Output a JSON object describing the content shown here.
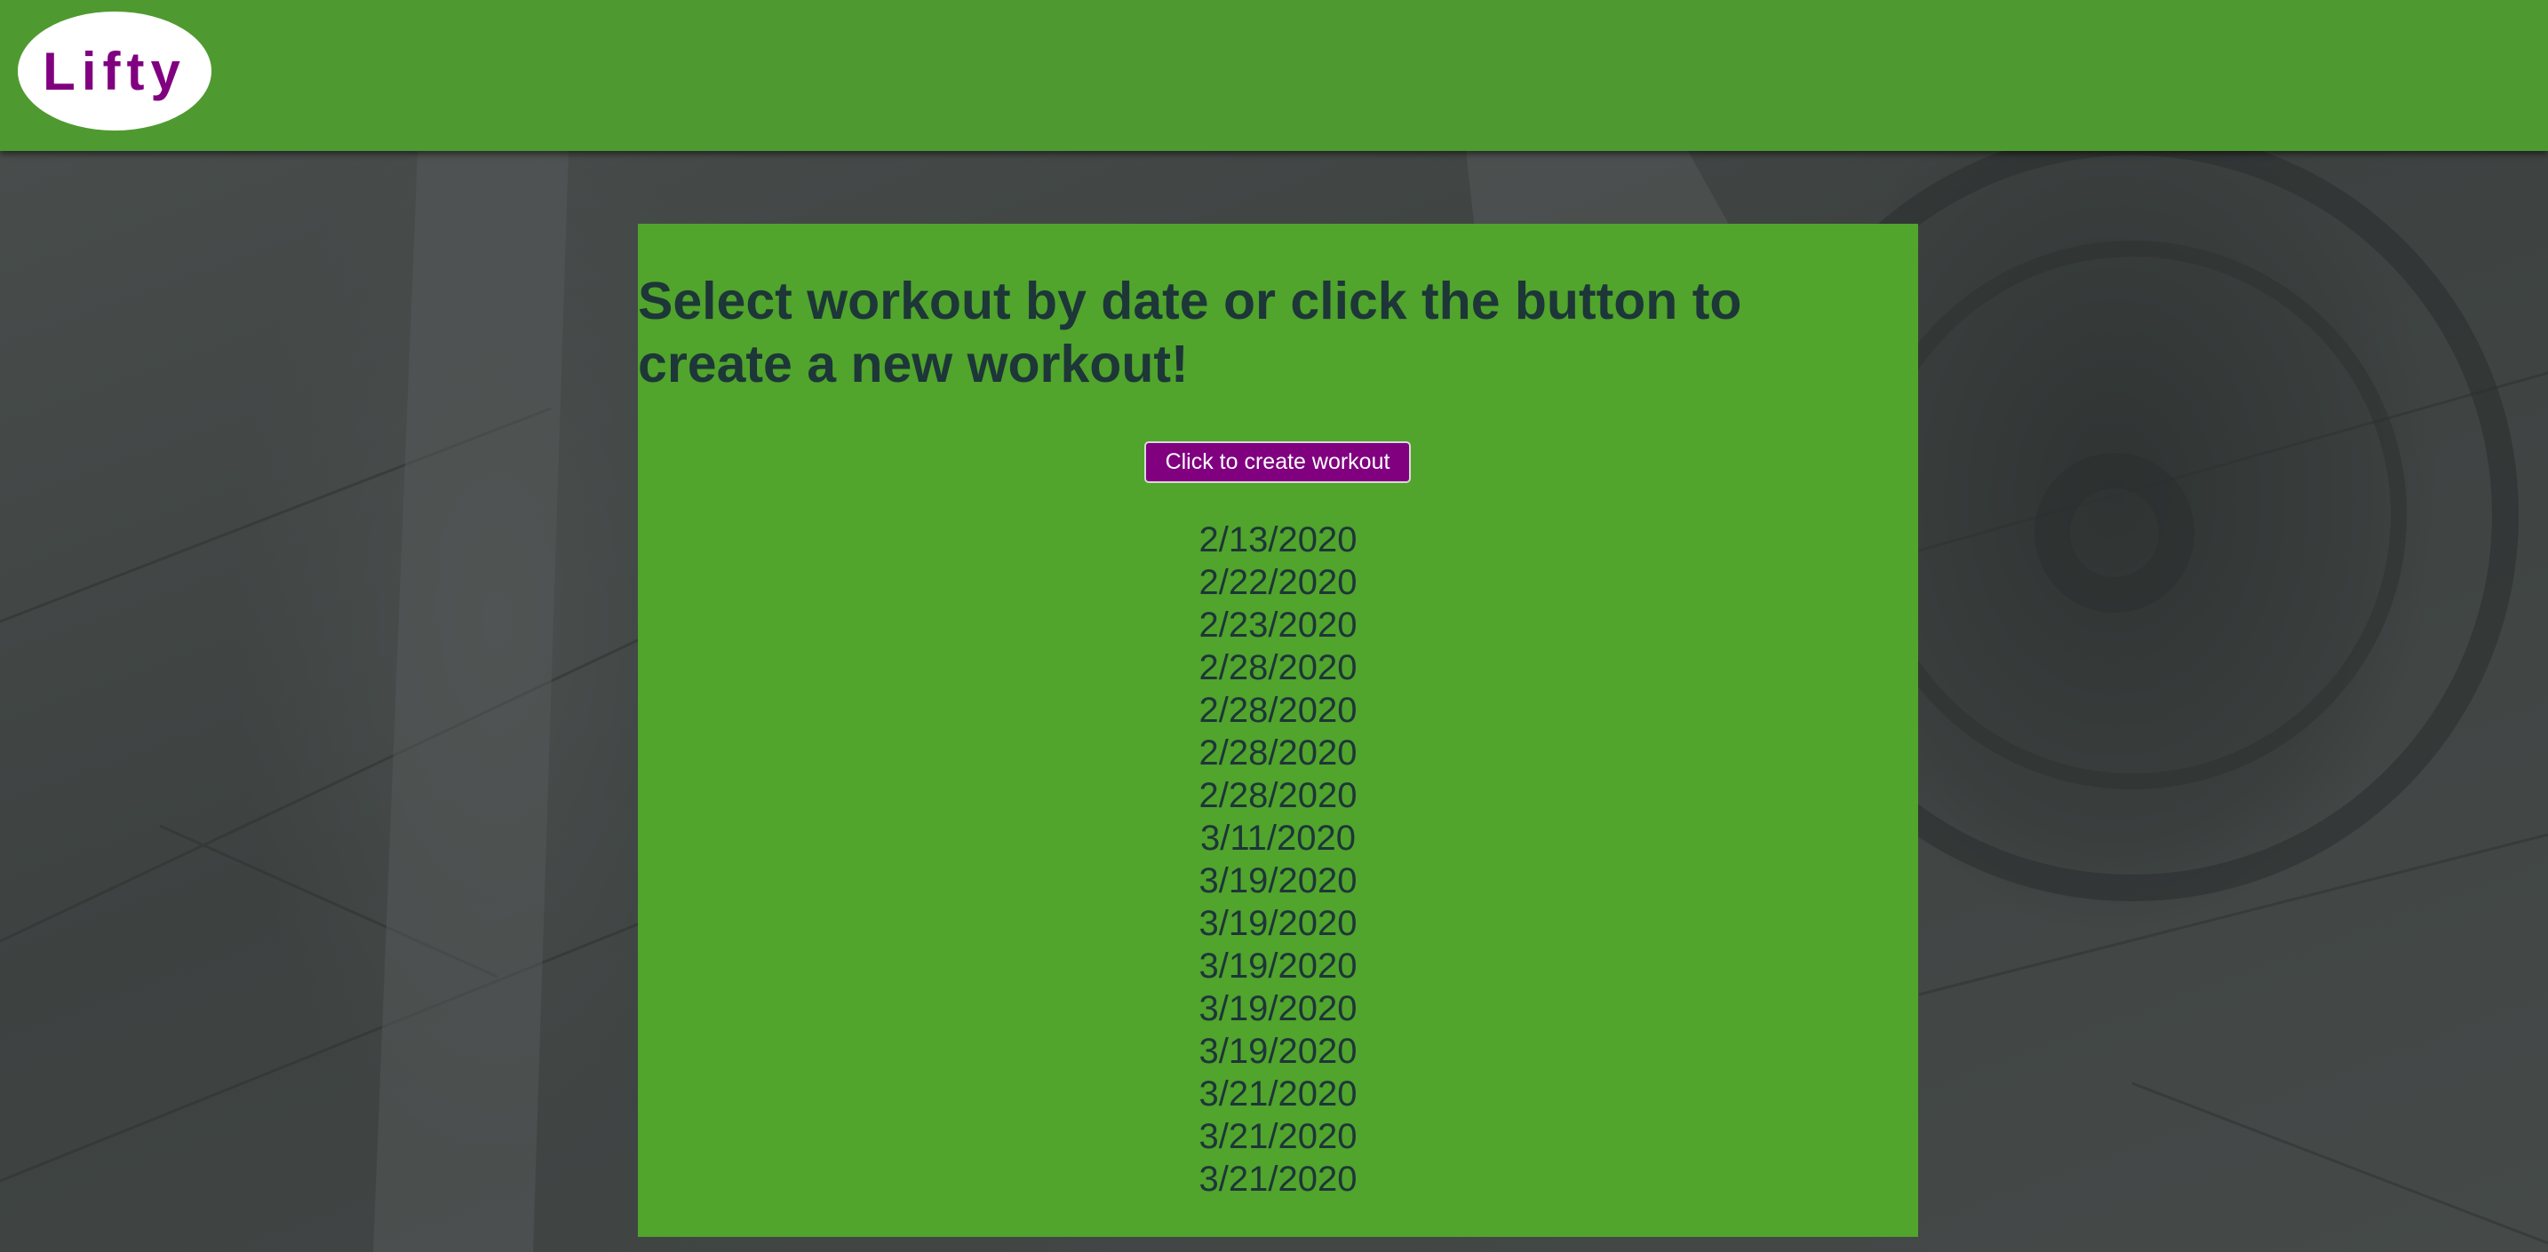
{
  "navbar": {
    "logo_text": "Lifty"
  },
  "main": {
    "heading": "Select workout by date or click the button to create a new workout!",
    "create_button_label": "Click to create workout",
    "workout_dates": [
      "2/13/2020",
      "2/22/2020",
      "2/23/2020",
      "2/28/2020",
      "2/28/2020",
      "2/28/2020",
      "2/28/2020",
      "3/11/2020",
      "3/19/2020",
      "3/19/2020",
      "3/19/2020",
      "3/19/2020",
      "3/19/2020",
      "3/21/2020",
      "3/21/2020",
      "3/21/2020"
    ]
  },
  "colors": {
    "navbar_bg": "#4f9a30",
    "panel_bg": "#51a42c",
    "brand_purple": "#800080",
    "text_dark": "#1d3638",
    "button_text": "#ffffff"
  }
}
